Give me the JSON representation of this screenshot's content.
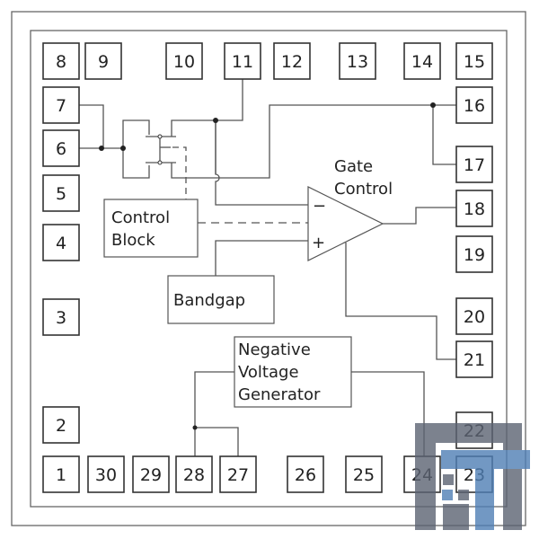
{
  "pins": {
    "p1": "1",
    "p2": "2",
    "p3": "3",
    "p4": "4",
    "p5": "5",
    "p6": "6",
    "p7": "7",
    "p8": "8",
    "p9": "9",
    "p10": "10",
    "p11": "11",
    "p12": "12",
    "p13": "13",
    "p14": "14",
    "p15": "15",
    "p16": "16",
    "p17": "17",
    "p18": "18",
    "p19": "19",
    "p20": "20",
    "p21": "21",
    "p22": "22",
    "p23": "23",
    "p24": "24",
    "p25": "25",
    "p26": "26",
    "p27": "27",
    "p28": "28",
    "p29": "29",
    "p30": "30"
  },
  "blocks": {
    "control_block": [
      "Control",
      "Block"
    ],
    "bandgap": "Bandgap",
    "negative_voltage_generator": [
      "Negative",
      "Voltage",
      "Generator"
    ],
    "gate_control": [
      "Gate",
      "Control"
    ],
    "amp_minus": "−",
    "amp_plus": "+"
  },
  "colors": {
    "watermark_gray": "#5c6373",
    "watermark_blue": "#4f7fb5"
  }
}
